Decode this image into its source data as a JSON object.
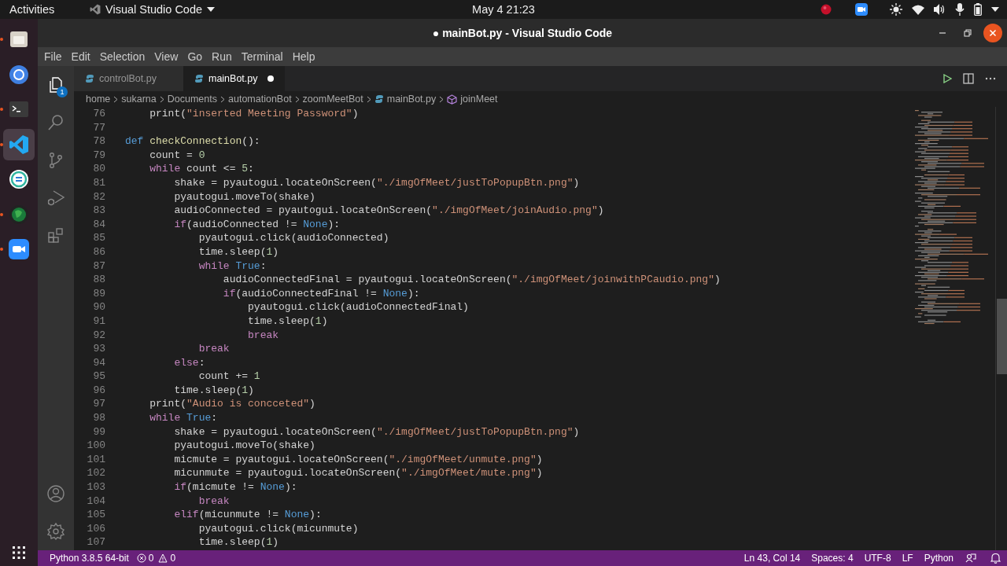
{
  "top_bar": {
    "activities": "Activities",
    "app_menu": "Visual Studio Code",
    "clock": "May 4  21:23"
  },
  "dock": [
    {
      "kind": "files",
      "running": true,
      "selected": false
    },
    {
      "kind": "browser",
      "running": false,
      "selected": false
    },
    {
      "kind": "terminal",
      "running": true,
      "selected": false
    },
    {
      "kind": "editor",
      "running": true,
      "selected": true
    },
    {
      "kind": "sync",
      "running": false,
      "selected": false
    },
    {
      "kind": "globe",
      "running": true,
      "selected": false
    },
    {
      "kind": "video",
      "running": true,
      "selected": false
    }
  ],
  "window": {
    "title": "● mainBot.py - Visual Studio Code"
  },
  "menu": [
    "File",
    "Edit",
    "Selection",
    "View",
    "Go",
    "Run",
    "Terminal",
    "Help"
  ],
  "activity_bar": [
    {
      "kind": "explorer",
      "selected": true,
      "badge": "1"
    },
    {
      "kind": "search",
      "selected": false
    },
    {
      "kind": "source-control",
      "selected": false
    },
    {
      "kind": "run",
      "selected": false
    },
    {
      "kind": "extensions",
      "selected": false
    }
  ],
  "tabs": [
    {
      "label": "controlBot.py",
      "selected": false,
      "modified": false
    },
    {
      "label": "mainBot.py",
      "selected": true,
      "modified": true
    }
  ],
  "breadcrumbs": [
    {
      "label": "home",
      "kind": "folder"
    },
    {
      "label": "sukarna",
      "kind": "folder"
    },
    {
      "label": "Documents",
      "kind": "folder"
    },
    {
      "label": "automationBot",
      "kind": "folder"
    },
    {
      "label": "zoomMeetBot",
      "kind": "folder"
    },
    {
      "label": "mainBot.py",
      "kind": "file"
    },
    {
      "label": "joinMeet",
      "kind": "symbol"
    }
  ],
  "code": [
    {
      "number": "76",
      "tokens": [
        {
          "text": "    print(",
          "kind": "plain"
        },
        {
          "text": "\"inserted Meeting Password\"",
          "kind": "string"
        },
        {
          "text": ")",
          "kind": "plain"
        }
      ]
    },
    {
      "number": "77"
    },
    {
      "number": "78",
      "tokens": [
        {
          "text": "def ",
          "kind": "storage"
        },
        {
          "text": "checkConnection",
          "kind": "function"
        },
        {
          "text": "():",
          "kind": "plain"
        }
      ]
    },
    {
      "number": "79",
      "tokens": [
        {
          "text": "    count = ",
          "kind": "plain"
        },
        {
          "text": "0",
          "kind": "number"
        }
      ]
    },
    {
      "number": "80",
      "tokens": [
        {
          "text": "    while",
          "kind": "keyword"
        },
        {
          "text": " count <= ",
          "kind": "plain"
        },
        {
          "text": "5",
          "kind": "number"
        },
        {
          "text": ":",
          "kind": "plain"
        }
      ]
    },
    {
      "number": "81",
      "tokens": [
        {
          "text": "        shake = pyautogui.locateOnScreen(",
          "kind": "plain"
        },
        {
          "text": "\"./imgOfMeet/justToPopupBtn.png\"",
          "kind": "string"
        },
        {
          "text": ")",
          "kind": "plain"
        }
      ]
    },
    {
      "number": "82",
      "tokens": [
        {
          "text": "        pyautogui.moveTo(shake)",
          "kind": "plain"
        }
      ]
    },
    {
      "number": "83",
      "tokens": [
        {
          "text": "        audioConnected = pyautogui.locateOnScreen(",
          "kind": "plain"
        },
        {
          "text": "\"./imgOfMeet/joinAudio.png\"",
          "kind": "string"
        },
        {
          "text": ")",
          "kind": "plain"
        }
      ]
    },
    {
      "number": "84",
      "tokens": [
        {
          "text": "        if",
          "kind": "keyword"
        },
        {
          "text": "(audioConnected != ",
          "kind": "plain"
        },
        {
          "text": "None",
          "kind": "constant"
        },
        {
          "text": "):",
          "kind": "plain"
        }
      ]
    },
    {
      "number": "85",
      "tokens": [
        {
          "text": "            pyautogui.click(audioConnected)",
          "kind": "plain"
        }
      ]
    },
    {
      "number": "86",
      "tokens": [
        {
          "text": "            time.sleep(",
          "kind": "plain"
        },
        {
          "text": "1",
          "kind": "number"
        },
        {
          "text": ")",
          "kind": "plain"
        }
      ]
    },
    {
      "number": "87",
      "tokens": [
        {
          "text": "            while",
          "kind": "keyword"
        },
        {
          "text": " True",
          "kind": "constant"
        },
        {
          "text": ":",
          "kind": "plain"
        }
      ]
    },
    {
      "number": "88",
      "tokens": [
        {
          "text": "                audioConnectedFinal = pyautogui.locateOnScreen(",
          "kind": "plain"
        },
        {
          "text": "\"./imgOfMeet/joinwithPCaudio.png\"",
          "kind": "string"
        },
        {
          "text": ")",
          "kind": "plain"
        }
      ]
    },
    {
      "number": "89",
      "tokens": [
        {
          "text": "                if",
          "kind": "keyword"
        },
        {
          "text": "(audioConnectedFinal != ",
          "kind": "plain"
        },
        {
          "text": "None",
          "kind": "constant"
        },
        {
          "text": "):",
          "kind": "plain"
        }
      ]
    },
    {
      "number": "90",
      "tokens": [
        {
          "text": "                    pyautogui.click(audioConnectedFinal)",
          "kind": "plain"
        }
      ]
    },
    {
      "number": "91",
      "tokens": [
        {
          "text": "                    time.sleep(",
          "kind": "plain"
        },
        {
          "text": "1",
          "kind": "number"
        },
        {
          "text": ")",
          "kind": "plain"
        }
      ]
    },
    {
      "number": "92",
      "tokens": [
        {
          "text": "                    break",
          "kind": "keyword"
        }
      ]
    },
    {
      "number": "93",
      "tokens": [
        {
          "text": "            break",
          "kind": "keyword"
        }
      ]
    },
    {
      "number": "94",
      "tokens": [
        {
          "text": "        else",
          "kind": "keyword"
        },
        {
          "text": ":",
          "kind": "plain"
        }
      ]
    },
    {
      "number": "95",
      "tokens": [
        {
          "text": "            count += ",
          "kind": "plain"
        },
        {
          "text": "1",
          "kind": "number"
        }
      ]
    },
    {
      "number": "96",
      "tokens": [
        {
          "text": "        time.sleep(",
          "kind": "plain"
        },
        {
          "text": "1",
          "kind": "number"
        },
        {
          "text": ")",
          "kind": "plain"
        }
      ]
    },
    {
      "number": "97",
      "tokens": [
        {
          "text": "    print(",
          "kind": "plain"
        },
        {
          "text": "\"Audio is concceted\"",
          "kind": "string"
        },
        {
          "text": ")",
          "kind": "plain"
        }
      ]
    },
    {
      "number": "98",
      "tokens": [
        {
          "text": "    while",
          "kind": "keyword"
        },
        {
          "text": " True",
          "kind": "constant"
        },
        {
          "text": ":",
          "kind": "plain"
        }
      ]
    },
    {
      "number": "99",
      "tokens": [
        {
          "text": "        shake = pyautogui.locateOnScreen(",
          "kind": "plain"
        },
        {
          "text": "\"./imgOfMeet/justToPopupBtn.png\"",
          "kind": "string"
        },
        {
          "text": ")",
          "kind": "plain"
        }
      ]
    },
    {
      "number": "100",
      "tokens": [
        {
          "text": "        pyautogui.moveTo(shake)",
          "kind": "plain"
        }
      ]
    },
    {
      "number": "101",
      "tokens": [
        {
          "text": "        micmute = pyautogui.locateOnScreen(",
          "kind": "plain"
        },
        {
          "text": "\"./imgOfMeet/unmute.png\"",
          "kind": "string"
        },
        {
          "text": ")",
          "kind": "plain"
        }
      ]
    },
    {
      "number": "102",
      "tokens": [
        {
          "text": "        micunmute = pyautogui.locateOnScreen(",
          "kind": "plain"
        },
        {
          "text": "\"./imgOfMeet/mute.png\"",
          "kind": "string"
        },
        {
          "text": ")",
          "kind": "plain"
        }
      ]
    },
    {
      "number": "103",
      "tokens": [
        {
          "text": "        if",
          "kind": "keyword"
        },
        {
          "text": "(micmute != ",
          "kind": "plain"
        },
        {
          "text": "None",
          "kind": "constant"
        },
        {
          "text": "):",
          "kind": "plain"
        }
      ]
    },
    {
      "number": "104",
      "tokens": [
        {
          "text": "            break",
          "kind": "keyword"
        }
      ]
    },
    {
      "number": "105",
      "tokens": [
        {
          "text": "        elif",
          "kind": "keyword"
        },
        {
          "text": "(micunmute != ",
          "kind": "plain"
        },
        {
          "text": "None",
          "kind": "constant"
        },
        {
          "text": "):",
          "kind": "plain"
        }
      ]
    },
    {
      "number": "106",
      "tokens": [
        {
          "text": "            pyautogui.click(micunmute)",
          "kind": "plain"
        }
      ]
    },
    {
      "number": "107",
      "tokens": [
        {
          "text": "            time.sleep(",
          "kind": "plain"
        },
        {
          "text": "1",
          "kind": "number"
        },
        {
          "text": ")",
          "kind": "plain"
        }
      ]
    }
  ],
  "status_bar": {
    "interpreter": "Python 3.8.5 64-bit",
    "errors": "0",
    "warnings": "0",
    "items": [
      "Ln 43, Col 14",
      "Spaces: 4",
      "UTF-8",
      "LF",
      "Python"
    ]
  }
}
